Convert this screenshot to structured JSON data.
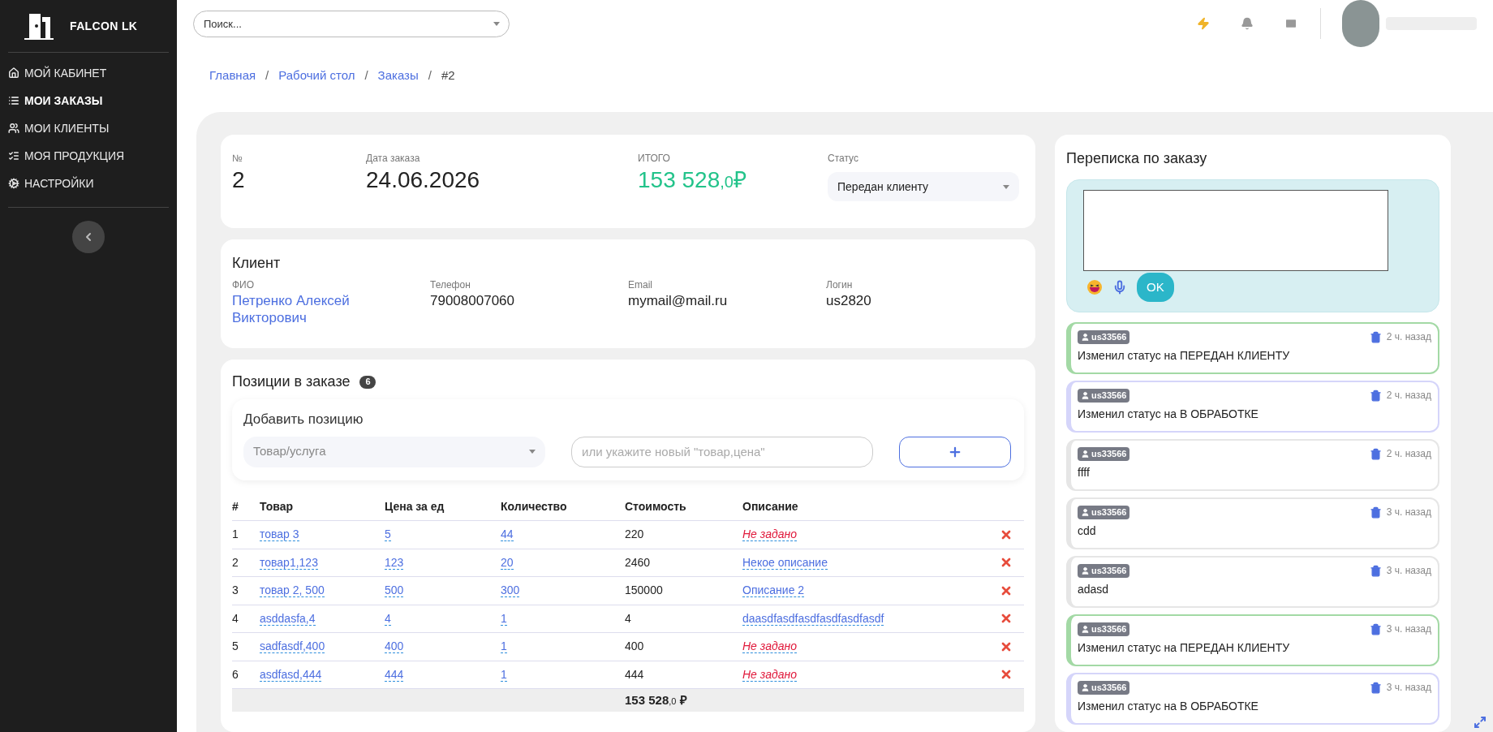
{
  "sidebar": {
    "brand": "FALCON LK",
    "items": [
      {
        "label": "МОЙ КАБИНЕТ",
        "selected": false
      },
      {
        "label": "МОИ ЗАКАЗЫ",
        "selected": true
      },
      {
        "label": "МОИ КЛИЕНТЫ",
        "selected": false
      },
      {
        "label": "МОЯ ПРОДУКЦИЯ",
        "selected": false
      },
      {
        "label": "НАСТРОЙКИ",
        "selected": false
      }
    ]
  },
  "header": {
    "search": {
      "placeholder": "Поиск..."
    }
  },
  "breadcrumbs": [
    {
      "label": "Главная",
      "kind": "link"
    },
    {
      "label": "/",
      "kind": "separator"
    },
    {
      "label": "Рабочий стол",
      "kind": "link"
    },
    {
      "label": "/",
      "kind": "separator"
    },
    {
      "label": "Заказы",
      "kind": "link"
    },
    {
      "label": "/",
      "kind": "separator"
    },
    {
      "label": "#2",
      "kind": "current"
    }
  ],
  "order": {
    "number_label": "№",
    "number": "2",
    "date_label": "Дата заказа",
    "date": "24.06.2026",
    "total_label": "ИТОГО",
    "total_main": "153 528",
    "total_fraction": ",0",
    "total_currency": "₽",
    "status_label": "Статус",
    "status": "Передан клиенту"
  },
  "client": {
    "title": "Клиент",
    "fields": [
      {
        "label": "ФИО",
        "value": "Петренко Алексей Викторович",
        "kind": "link"
      },
      {
        "label": "Телефон",
        "value": "79008007060",
        "kind": "text"
      },
      {
        "label": "Email",
        "value": "mymail@mail.ru",
        "kind": "text"
      },
      {
        "label": "Логин",
        "value": "us2820",
        "kind": "text"
      }
    ]
  },
  "positions": {
    "title": "Позиции в заказе",
    "count": "6",
    "add": {
      "title": "Добавить позицию",
      "select_placeholder": "Товар/услуга",
      "input_placeholder": "или укажите новый \"товар,цена\""
    },
    "columns": [
      "#",
      "Товар",
      "Цена за ед",
      "Количество",
      "Стоимость",
      "Описание"
    ],
    "rows": [
      {
        "n": "1",
        "product": "товар 3",
        "price": "5",
        "qty": "44",
        "cost": "220",
        "description": "Не задано",
        "kind": "empty"
      },
      {
        "n": "2",
        "product": "товар1,123",
        "price": "123",
        "qty": "20",
        "cost": "2460",
        "description": "Некое описание",
        "kind": "value"
      },
      {
        "n": "3",
        "product": "товар 2, 500",
        "price": "500",
        "qty": "300",
        "cost": "150000",
        "description": "Описание 2",
        "kind": "value"
      },
      {
        "n": "4",
        "product": "asddasfa,4",
        "price": "4",
        "qty": "1",
        "cost": "4",
        "description": "daasdfasdfasdfasdfasdfasdf",
        "kind": "value"
      },
      {
        "n": "5",
        "product": "sadfasdf,400",
        "price": "400",
        "qty": "1",
        "cost": "400",
        "description": "Не задано",
        "kind": "empty"
      },
      {
        "n": "6",
        "product": "asdfasd,444",
        "price": "444",
        "qty": "1",
        "cost": "444",
        "description": "Не задано",
        "kind": "empty"
      }
    ],
    "total_main": "153 528",
    "total_fraction": ",0",
    "total_currency": "₽"
  },
  "chat": {
    "title": "Переписка по заказу",
    "send": "OK",
    "messages": [
      {
        "user": "us33566",
        "time": "2 ч. назад",
        "text": "Изменил статус на ПЕРЕДАН КЛИЕНТУ",
        "color": "#a3d9a5"
      },
      {
        "user": "us33566",
        "time": "2 ч. назад",
        "text": "Изменил статус на В ОБРАБОТКЕ",
        "color": "#d5d5fa"
      },
      {
        "user": "us33566",
        "time": "2 ч. назад",
        "text": "ffff",
        "color": "#e6e6e6"
      },
      {
        "user": "us33566",
        "time": "3 ч. назад",
        "text": "cdd",
        "color": "#e6e6e6"
      },
      {
        "user": "us33566",
        "time": "3 ч. назад",
        "text": "adasd",
        "color": "#e6e6e6"
      },
      {
        "user": "us33566",
        "time": "3 ч. назад",
        "text": "Изменил статус на ПЕРЕДАН КЛИЕНТУ",
        "color": "#a3d9a5"
      },
      {
        "user": "us33566",
        "time": "3 ч. назад",
        "text": "Изменил статус на В ОБРАБОТКЕ",
        "color": "#d5d5fa"
      }
    ]
  }
}
